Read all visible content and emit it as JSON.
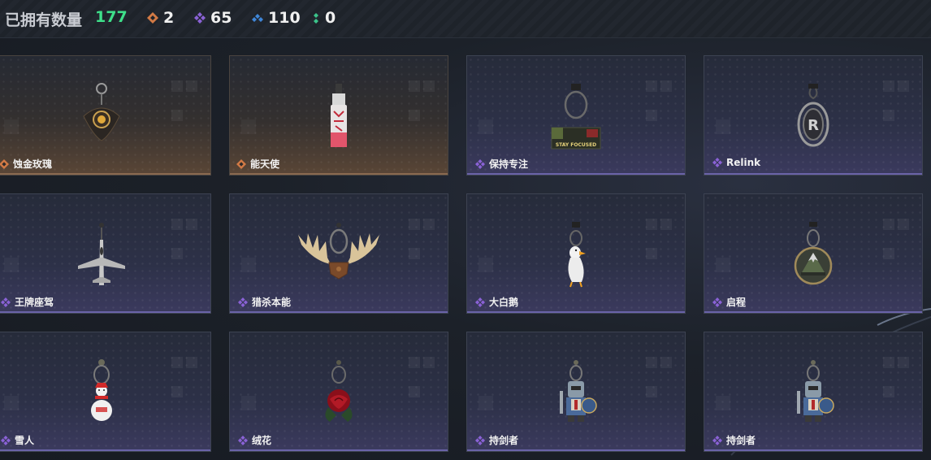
{
  "header": {
    "owned_label": "已拥有数量",
    "owned_count": "177",
    "stats": [
      {
        "icon": "orange-rarity-icon",
        "color": "#d27a45",
        "value": "2"
      },
      {
        "icon": "purple-rarity-icon",
        "color": "#8a62d6",
        "value": "65"
      },
      {
        "icon": "blue-rarity-icon",
        "color": "#3f86d8",
        "value": "110"
      },
      {
        "icon": "green-rarity-icon",
        "color": "#3bc48a",
        "value": "0"
      }
    ]
  },
  "items": [
    {
      "name": "蚀金玫瑰",
      "rarity": "orange",
      "icon": "gold-rose-charm-icon"
    },
    {
      "name": "能天使",
      "rarity": "orange",
      "icon": "exusiai-bottle-charm-icon"
    },
    {
      "name": "保持专注",
      "rarity": "purple",
      "icon": "stay-focused-charm-icon",
      "charm_text": "STAY FOCUSED"
    },
    {
      "name": "Relink",
      "rarity": "purple",
      "icon": "relink-charm-icon",
      "charm_text": "R"
    },
    {
      "name": "王牌座驾",
      "rarity": "purple",
      "icon": "jet-plane-charm-icon"
    },
    {
      "name": "猎杀本能",
      "rarity": "purple",
      "icon": "antler-charm-icon"
    },
    {
      "name": "大白鹅",
      "rarity": "purple",
      "icon": "white-goose-charm-icon"
    },
    {
      "name": "启程",
      "rarity": "purple",
      "icon": "mountain-badge-charm-icon"
    },
    {
      "name": "雪人",
      "rarity": "purple",
      "icon": "snowman-charm-icon"
    },
    {
      "name": "绒花",
      "rarity": "purple",
      "icon": "red-rose-charm-icon"
    },
    {
      "name": "持剑者",
      "rarity": "purple",
      "icon": "sword-knight-charm-icon"
    },
    {
      "name": "持剑者",
      "rarity": "purple",
      "icon": "sword-knight-charm-icon"
    }
  ],
  "colors": {
    "orange": "#d27a45",
    "purple": "#8a62d6",
    "accent_green": "#3ee08a"
  }
}
